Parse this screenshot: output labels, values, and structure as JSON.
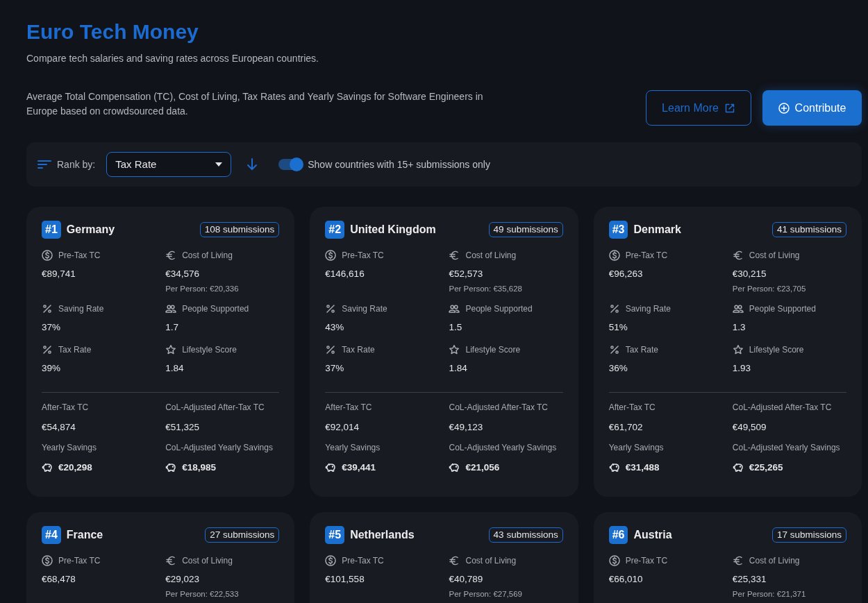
{
  "header": {
    "title": "Euro Tech Money",
    "subtitle": "Compare tech salaries and saving rates across European countries.",
    "description": "Average Total Compensation (TC), Cost of Living, Tax Rates and Yearly Savings for Software Engineers in Europe based on crowdsourced data."
  },
  "buttons": [
    {
      "kind": "outline",
      "label": "Learn More"
    },
    {
      "kind": "primary",
      "label": "Contribute"
    }
  ],
  "filters": {
    "rank_label": "Rank by:",
    "rank_value": "Tax Rate",
    "toggle_on": true,
    "toggle_label": "Show countries with 15+ submissions only"
  },
  "cards": [
    {
      "rank": "#1",
      "country": "Germany",
      "submissions": "108 submissions",
      "metrics": [
        {
          "kind": "dollar",
          "label": "Pre-Tax TC",
          "value": "€89,741"
        },
        {
          "kind": "euro",
          "label": "Cost of Living",
          "value": "€34,576",
          "note": "Per Person: €20,336"
        },
        {
          "kind": "percent",
          "label": "Saving Rate",
          "value": "37%"
        },
        {
          "kind": "people",
          "label": "People Supported",
          "value": "1.7"
        },
        {
          "kind": "percent",
          "label": "Tax Rate",
          "value": "39%"
        },
        {
          "kind": "star",
          "label": "Lifestyle Score",
          "value": "1.84"
        }
      ],
      "totals": [
        {
          "kind": "plain",
          "label": "After-Tax TC",
          "value": "€54,874"
        },
        {
          "kind": "plain",
          "label": "CoL-Adjusted After-Tax TC",
          "value": "€51,325"
        },
        {
          "kind": "savings",
          "label": "Yearly Savings",
          "value": "€20,298"
        },
        {
          "kind": "savings",
          "label": "CoL-Adjusted Yearly Savings",
          "value": "€18,985"
        }
      ]
    },
    {
      "rank": "#2",
      "country": "United Kingdom",
      "submissions": "49 submissions",
      "metrics": [
        {
          "kind": "dollar",
          "label": "Pre-Tax TC",
          "value": "€146,616"
        },
        {
          "kind": "euro",
          "label": "Cost of Living",
          "value": "€52,573",
          "note": "Per Person: €35,628"
        },
        {
          "kind": "percent",
          "label": "Saving Rate",
          "value": "43%"
        },
        {
          "kind": "people",
          "label": "People Supported",
          "value": "1.5"
        },
        {
          "kind": "percent",
          "label": "Tax Rate",
          "value": "37%"
        },
        {
          "kind": "star",
          "label": "Lifestyle Score",
          "value": "1.84"
        }
      ],
      "totals": [
        {
          "kind": "plain",
          "label": "After-Tax TC",
          "value": "€92,014"
        },
        {
          "kind": "plain",
          "label": "CoL-Adjusted After-Tax TC",
          "value": "€49,123"
        },
        {
          "kind": "savings",
          "label": "Yearly Savings",
          "value": "€39,441"
        },
        {
          "kind": "savings",
          "label": "CoL-Adjusted Yearly Savings",
          "value": "€21,056"
        }
      ]
    },
    {
      "rank": "#3",
      "country": "Denmark",
      "submissions": "41 submissions",
      "metrics": [
        {
          "kind": "dollar",
          "label": "Pre-Tax TC",
          "value": "€96,263"
        },
        {
          "kind": "euro",
          "label": "Cost of Living",
          "value": "€30,215",
          "note": "Per Person: €23,705"
        },
        {
          "kind": "percent",
          "label": "Saving Rate",
          "value": "51%"
        },
        {
          "kind": "people",
          "label": "People Supported",
          "value": "1.3"
        },
        {
          "kind": "percent",
          "label": "Tax Rate",
          "value": "36%"
        },
        {
          "kind": "star",
          "label": "Lifestyle Score",
          "value": "1.93"
        }
      ],
      "totals": [
        {
          "kind": "plain",
          "label": "After-Tax TC",
          "value": "€61,702"
        },
        {
          "kind": "plain",
          "label": "CoL-Adjusted After-Tax TC",
          "value": "€49,509"
        },
        {
          "kind": "savings",
          "label": "Yearly Savings",
          "value": "€31,488"
        },
        {
          "kind": "savings",
          "label": "CoL-Adjusted Yearly Savings",
          "value": "€25,265"
        }
      ]
    },
    {
      "rank": "#4",
      "country": "France",
      "submissions": "27 submissions",
      "metrics": [
        {
          "kind": "dollar",
          "label": "Pre-Tax TC",
          "value": "€68,478"
        },
        {
          "kind": "euro",
          "label": "Cost of Living",
          "value": "€29,023",
          "note": "Per Person: €22,533"
        }
      ]
    },
    {
      "rank": "#5",
      "country": "Netherlands",
      "submissions": "43 submissions",
      "metrics": [
        {
          "kind": "dollar",
          "label": "Pre-Tax TC",
          "value": "€101,558"
        },
        {
          "kind": "euro",
          "label": "Cost of Living",
          "value": "€40,789",
          "note": "Per Person: €27,569"
        }
      ]
    },
    {
      "rank": "#6",
      "country": "Austria",
      "submissions": "17 submissions",
      "metrics": [
        {
          "kind": "dollar",
          "label": "Pre-Tax TC",
          "value": "€66,010"
        },
        {
          "kind": "euro",
          "label": "Cost of Living",
          "value": "€25,331",
          "note": "Per Person: €21,371"
        }
      ]
    }
  ]
}
